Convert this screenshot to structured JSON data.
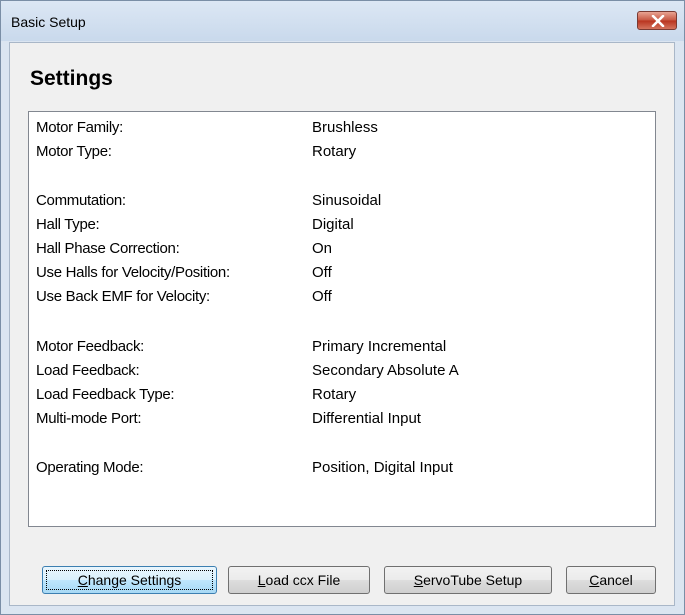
{
  "window": {
    "title": "Basic Setup"
  },
  "heading": "Settings",
  "settings": [
    {
      "label": "Motor Family:",
      "value": "Brushless"
    },
    {
      "label": "Motor Type:",
      "value": "Rotary"
    },
    {
      "label": "Commutation:",
      "value": "Sinusoidal"
    },
    {
      "label": "Hall Type:",
      "value": "Digital"
    },
    {
      "label": "Hall Phase Correction:",
      "value": "On"
    },
    {
      "label": "Use Halls for Velocity/Position:",
      "value": "Off"
    },
    {
      "label": "Use Back EMF for Velocity:",
      "value": "Off"
    },
    {
      "label": "Motor Feedback:",
      "value": "Primary Incremental"
    },
    {
      "label": "Load Feedback:",
      "value": "Secondary Absolute A"
    },
    {
      "label": "Load Feedback Type:",
      "value": "Rotary"
    },
    {
      "label": "Multi-mode Port:",
      "value": "Differential Input"
    },
    {
      "label": "Operating Mode:",
      "value": "Position, Digital Input"
    }
  ],
  "buttons": {
    "change_settings": {
      "prefix": "",
      "mnemonic": "C",
      "rest": "hange Settings"
    },
    "load_ccx": {
      "prefix": "",
      "mnemonic": "L",
      "rest": "oad ccx File"
    },
    "servotube": {
      "prefix": "",
      "mnemonic": "S",
      "rest": "ervoTube Setup"
    },
    "cancel": {
      "prefix": "",
      "mnemonic": "C",
      "rest": "ancel"
    }
  },
  "icons": {
    "close": "close-icon"
  },
  "colors": {
    "close_button": "#c65540",
    "window_frame": "#dbe5f1",
    "client_background": "#f0f0f0"
  }
}
